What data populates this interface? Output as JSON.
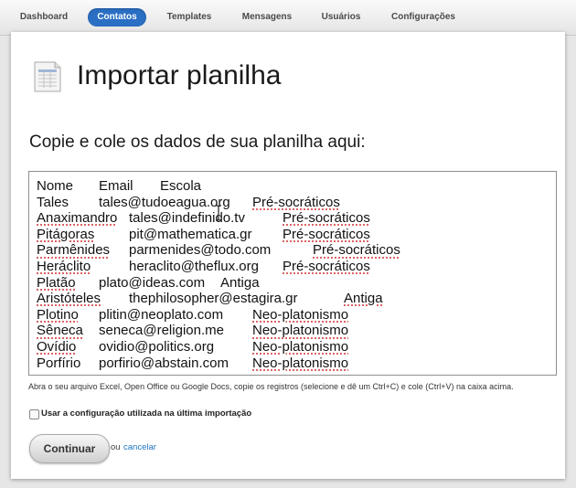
{
  "nav": {
    "items": [
      {
        "label": "Dashboard",
        "active": false
      },
      {
        "label": "Contatos",
        "active": true
      },
      {
        "label": "Templates",
        "active": false
      },
      {
        "label": "Mensagens",
        "active": false
      },
      {
        "label": "Usuários",
        "active": false
      },
      {
        "label": "Configurações",
        "active": false
      }
    ]
  },
  "page": {
    "title": "Importar planilha",
    "subtitle": "Copie e cole os dados de sua planilha aqui:",
    "icon": "spreadsheet-icon"
  },
  "paste": {
    "rows": [
      {
        "nome": "Nome",
        "email": "Email",
        "escola": "Escola"
      },
      {
        "nome": "Tales",
        "email": "tales@tudoeagua.org",
        "escola": "Pré-socráticos"
      },
      {
        "nome": "Anaximandro",
        "email": "tales@indefinido.tv",
        "escola": "Pré-socráticos"
      },
      {
        "nome": "Pitágoras",
        "email": "pit@mathematica.gr",
        "escola": "Pré-socráticos"
      },
      {
        "nome": "Parmênides",
        "email": "parmenides@todo.com",
        "escola": "Pré-socráticos"
      },
      {
        "nome": "Heráclito",
        "email": "heraclito@theflux.org",
        "escola": "Pré-socráticos"
      },
      {
        "nome": "Platão",
        "email": "plato@ideas.com",
        "escola": "Antiga"
      },
      {
        "nome": "Aristóteles",
        "email": "thephilosopher@estagira.gr",
        "escola": "Antiga"
      },
      {
        "nome": "Plotino",
        "email": "plitin@neoplato.com",
        "escola": "Neo-platonismo"
      },
      {
        "nome": "Sêneca",
        "email": "seneca@religion.me",
        "escola": "Neo-platonismo"
      },
      {
        "nome": "Ovídio",
        "email": "ovidio@politics.org",
        "escola": "Neo-platonismo"
      },
      {
        "nome": "Porfírio",
        "email": "porfirio@abstain.com",
        "escola": "Neo-platonismo"
      }
    ]
  },
  "help_text": "Abra o seu arquivo Excel, Open Office ou Google Docs, copie os registros (selecione e dê um Ctrl+C) e cole (Ctrl+V) na caixa acima.",
  "options": {
    "reuse_config_label": "Usar a configuração utilizada na última importação",
    "reuse_config_checked": false
  },
  "actions": {
    "continue_label": "Continuar",
    "or_text": "ou",
    "cancel_label": "cancelar"
  },
  "colors": {
    "nav_active": "#2a6fc4",
    "link": "#1e73be",
    "spellcheck": "#d03030"
  }
}
